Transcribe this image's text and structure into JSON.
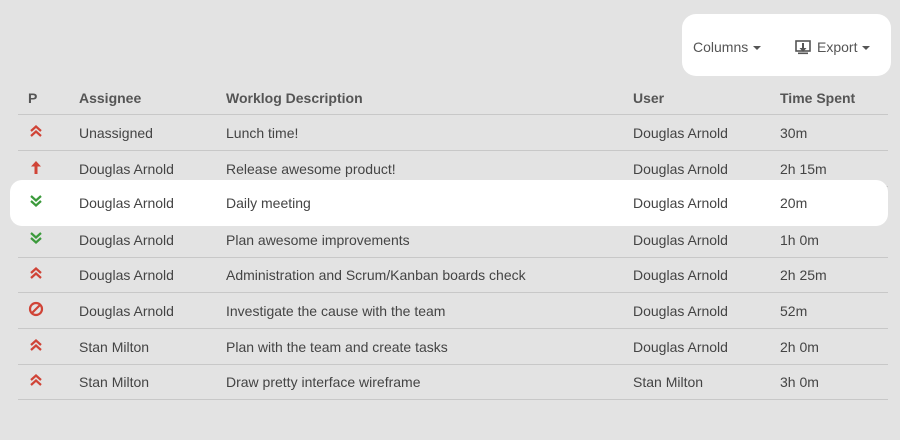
{
  "toolbar": {
    "columns_label": "Columns",
    "export_label": "Export"
  },
  "table": {
    "headers": {
      "p": "P",
      "assignee": "Assignee",
      "description": "Worklog Description",
      "user": "User",
      "time": "Time Spent"
    },
    "rows": [
      {
        "priority": "major",
        "priority_icon": "double-chevron-up-icon",
        "assignee": "Unassigned",
        "description": "Lunch time!",
        "user": "Douglas Arnold",
        "time": "30m"
      },
      {
        "priority": "critical",
        "priority_icon": "arrow-up-icon",
        "assignee": "Douglas Arnold",
        "description": "Release awesome product!",
        "user": "Douglas Arnold",
        "time": "2h 15m"
      },
      {
        "priority": "minor",
        "priority_icon": "double-chevron-down-icon",
        "assignee": "Douglas Arnold",
        "description": "Daily meeting",
        "user": "Douglas Arnold",
        "time": "20m"
      },
      {
        "priority": "minor",
        "priority_icon": "double-chevron-down-icon",
        "assignee": "Douglas Arnold",
        "description": "Plan awesome improvements",
        "user": "Douglas Arnold",
        "time": "1h 0m"
      },
      {
        "priority": "major",
        "priority_icon": "double-chevron-up-icon",
        "assignee": "Douglas Arnold",
        "description": "Administration and Scrum/Kanban boards check",
        "user": "Douglas Arnold",
        "time": "2h 25m"
      },
      {
        "priority": "blocker",
        "priority_icon": "blocker-icon",
        "assignee": "Douglas Arnold",
        "description": "Investigate the cause with the team",
        "user": "Douglas Arnold",
        "time": "52m"
      },
      {
        "priority": "major",
        "priority_icon": "double-chevron-up-icon",
        "assignee": "Stan Milton",
        "description": "Plan with the team and create tasks",
        "user": "Douglas Arnold",
        "time": "2h 0m"
      },
      {
        "priority": "major",
        "priority_icon": "double-chevron-up-icon",
        "assignee": "Stan Milton",
        "description": "Draw pretty interface wireframe",
        "user": "Stan Milton",
        "time": "3h 0m"
      }
    ]
  },
  "colors": {
    "background": "#e3e3e3",
    "high_priority": "#d04437",
    "low_priority": "#3b9a3b"
  }
}
